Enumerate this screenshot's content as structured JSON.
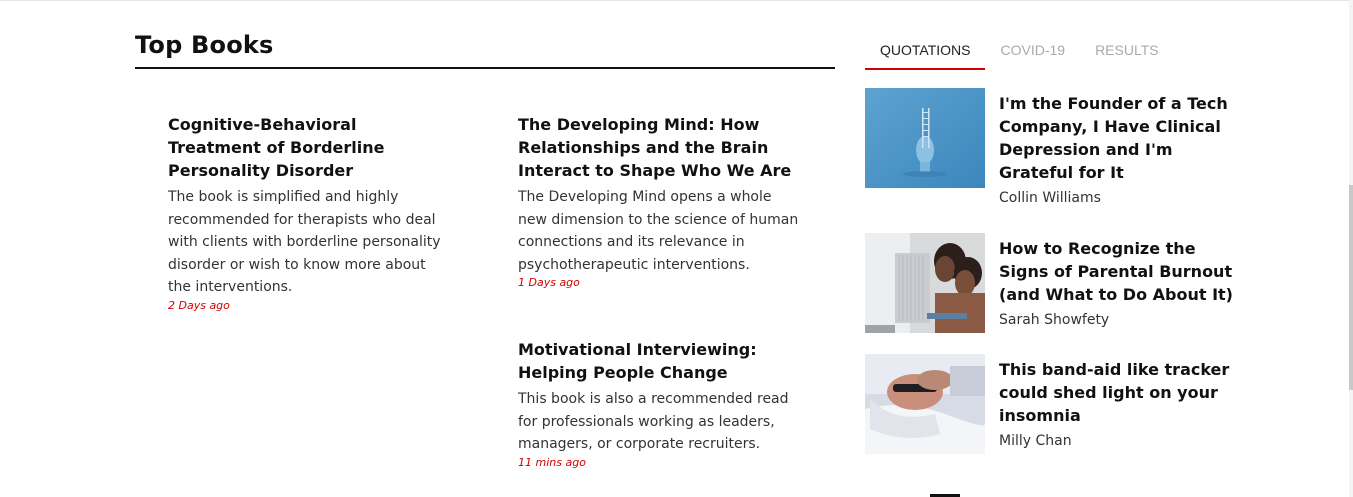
{
  "section": {
    "title": "Top Books"
  },
  "books": [
    {
      "title": "Cognitive-Behavioral Treatment of Borderline Personality Disorder",
      "description": "The book is simplified and highly recommended for therapists who deal with clients with borderline personality disorder or wish to know more about the interventions.",
      "time": "2 Days ago"
    },
    {
      "title": "The Developing Mind: How Relationships and the Brain Interact to Shape Who We Are",
      "description": "The Developing Mind opens a whole new dimension to the science of human connections and its relevance in psychotherapeutic interventions.",
      "time": "1 Days ago"
    },
    {
      "title": "Motivational Interviewing: Helping People Change",
      "description": "This book is also a recommended read for professionals working as leaders, managers, or corporate recruiters.",
      "time": "11 mins ago"
    }
  ],
  "tabs": [
    {
      "label": "QUOTATIONS",
      "active": true
    },
    {
      "label": "COVID-19",
      "active": false
    },
    {
      "label": "RESULTS",
      "active": false
    }
  ],
  "articles": [
    {
      "title": "I'm the Founder of a Tech Company, I Have Clinical Depression and I'm Grateful for It",
      "author": "Collin Williams",
      "image": "blue-head-ladder-image"
    },
    {
      "title": "How to Recognize the Signs of Parental Burnout (and What to Do About It)",
      "author": "Sarah Showfety",
      "image": "children-at-window-image"
    },
    {
      "title": "This band-aid like tracker could shed light on your insomnia",
      "author": "Milly Chan",
      "image": "sleeping-man-image"
    }
  ],
  "colors": {
    "accent": "#d40000",
    "heading": "#111111",
    "tab_inactive": "#aaaaaa"
  }
}
